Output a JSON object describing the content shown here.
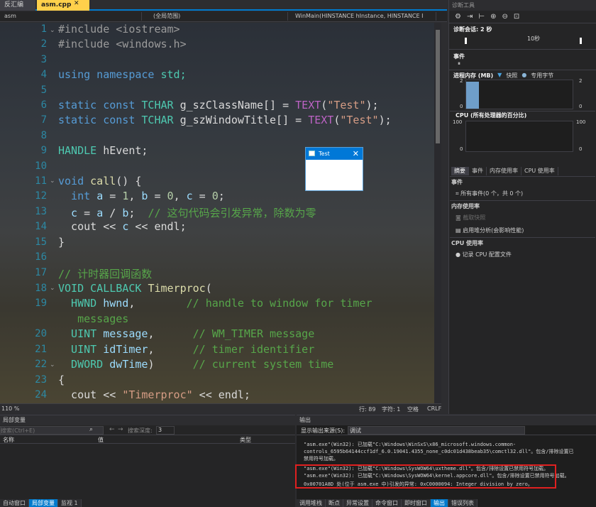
{
  "tabs": {
    "solution_tab": "反汇编",
    "file_tab": "asm.cpp",
    "file_tab_close": "✕"
  },
  "navbar": {
    "project": "asm",
    "scope": "(全局范围)",
    "function": "WinMain(HINSTANCE hInstance, HINSTANCE I"
  },
  "editor": {
    "line_numbers": [
      "1",
      "2",
      "3",
      "4",
      "5",
      "6",
      "7",
      "8",
      "9",
      "10",
      "11",
      "12",
      "13",
      "14",
      "15",
      "16",
      "17",
      "18",
      "19",
      "",
      "20",
      "21",
      "22",
      "23",
      "24"
    ],
    "lines": {
      "l1": "#include <iostream>",
      "l2": "#include <windows.h>",
      "l4a": "using namespace ",
      "l4b": "std;",
      "l6a": "static const ",
      "l6b": "TCHAR ",
      "l6c": "g_szClassName[] = ",
      "l6d": "TEXT",
      "l6e": "(",
      "l6f": "\"Test\"",
      "l6g": ");",
      "l7a": "static const ",
      "l7b": "TCHAR ",
      "l7c": "g_szWindowTitle[] = ",
      "l7d": "TEXT",
      "l7e": "(",
      "l7f": "\"Test\"",
      "l7g": ");",
      "l9a": "HANDLE ",
      "l9b": "hEvent;",
      "l11a": "void ",
      "l11b": "call",
      "l11c": "() {",
      "l12a": "  int ",
      "l12b": "a",
      "l12c": " = ",
      "l12d": "1",
      "l12e": ", ",
      "l12f": "b",
      "l12g": " = ",
      "l12h": "0",
      "l12i": ", ",
      "l12j": "c",
      "l12k": " = ",
      "l12l": "0",
      "l12m": ";",
      "l13a": "  c",
      "l13b": " = ",
      "l13c": "a",
      "l13d": " / ",
      "l13e": "b",
      "l13f": ";  ",
      "l13g": "// 这句代码会引发异常，除数为零",
      "l14a": "  cout << ",
      "l14b": "c",
      "l14c": " << endl;",
      "l15": "}",
      "l17": "// 计时器回调函数",
      "l18a": "VOID CALLBACK ",
      "l18b": "Timerproc",
      "l18c": "(",
      "l19a": "  HWND ",
      "l19b": "hwnd",
      "l19c": ",        ",
      "l19d": "// handle to window for timer",
      "l19e": "   messages",
      "l20a": "  UINT ",
      "l20b": "message",
      "l20c": ",      ",
      "l20d": "// WM_TIMER message",
      "l21a": "  UINT ",
      "l21b": "idTimer",
      "l21c": ",      ",
      "l21d": "// timer identifier",
      "l22a": "  DWORD ",
      "l22b": "dwTime",
      "l22c": ")      ",
      "l22d": "// current system time",
      "l23": "{",
      "l24a": "  cout << ",
      "l24b": "\"Timerproc\"",
      "l24c": " << endl;"
    }
  },
  "status": {
    "zoom": "110 %",
    "line": "行: 89",
    "char": "字符: 1",
    "mode": "空格",
    "eol": "CRLF"
  },
  "test_window": {
    "title": "Test",
    "close": "✕"
  },
  "diagnostics": {
    "title": "诊断工具",
    "session": "诊断会话: 2 秒",
    "timeline_label": "10秒",
    "events": "事件",
    "memory_header": "进程内存 (MB)",
    "snapshot": "快照",
    "private_bytes": "专用字节",
    "mem_left_max": "2",
    "mem_left_min": "0",
    "mem_right_max": "2",
    "mem_right_min": "0",
    "cpu_header": "CPU (所有处理器的百分比)",
    "cpu_left_max": "100",
    "cpu_left_min": "0",
    "cpu_right_max": "100",
    "cpu_right_min": "0",
    "tabs": [
      "摘要",
      "事件",
      "内存使用率",
      "CPU 使用率"
    ],
    "events_title": "事件",
    "all_events": "所有事件(0 个，共 0 个)",
    "memory_title": "内存使用率",
    "take_snapshot": "截取快照",
    "heap_profile": "启用堆分析(会影响性能)",
    "cpu_title": "CPU 使用率",
    "record_cpu": "记录 CPU 配置文件",
    "colors": {
      "snapshot": "#4aa3df",
      "private_bytes": "#8ab4d6",
      "memory_fill": "#6f9ec9"
    },
    "memory_fill_level": 0.95
  },
  "locals": {
    "title": "局部变量",
    "search_placeholder": "搜索(Ctrl+E)",
    "depth_label": "搜索深度:",
    "depth_value": "3",
    "columns": [
      "名称",
      "值",
      "类型"
    ],
    "tabs": [
      "自动窗口",
      "局部变量",
      "监视 1"
    ]
  },
  "output": {
    "title": "输出",
    "source_label": "显示输出来源(S):",
    "source_value": "调试",
    "lines": [
      "\"asm.exe\"(Win32): 已加载\"C:\\Windows\\WinSxS\\x86_microsoft.windows.common-",
      "controls_6595b64144ccf1df_6.0.19041.4355_none_c0dc01d438beab35\\comctl32.dll\"。包含/排除设置已",
      "禁用符号加载。",
      "\"asm.exe\"(Win32): 已加载\"C:\\Windows\\SysWOW64\\uxtheme.dll\"。包含/排除设置已禁用符号加载。",
      "\"asm.exe\"(Win32): 已加载\"C:\\Windows\\SysWOW64\\kernel.appcore.dll\"。包含/排除设置已禁用符号加载。",
      "0x00701A8D 处(位于 asm.exe 中)引发的异常: 0xC0000094: Integer division by zero。"
    ],
    "tabs": [
      "调用堆栈",
      "断点",
      "异常设置",
      "命令窗口",
      "即时窗口",
      "输出",
      "错误列表"
    ]
  }
}
